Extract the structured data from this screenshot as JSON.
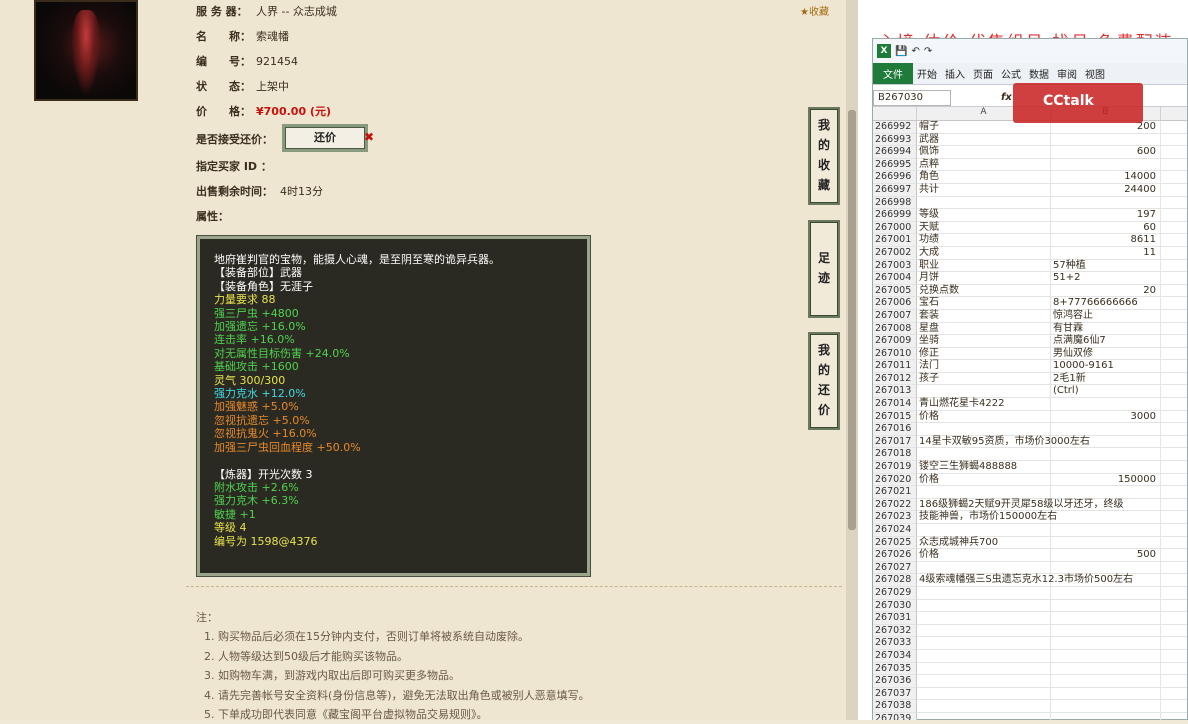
{
  "item": {
    "server_label": "服 务 器：",
    "server": "人界 -- 众志成城",
    "name_label": "名　　称：",
    "name": "索魂幡",
    "id_label": "编　　号：",
    "id": "921454",
    "status_label": "状　　态：",
    "status": "上架中",
    "price_label": "价　　格：",
    "price": "¥700.00 (元)",
    "bargain_label": "是否接受还价：",
    "bargain_button": "还价",
    "buyer_label": "指定买家 ID ：",
    "remaining_label": "出售剩余时间：",
    "remaining": "4时13分",
    "attr_label": "属性：",
    "favorite": "收藏"
  },
  "attributes": [
    {
      "text": "地府崔判官的宝物，能摄人心魂，是至阴至寒的诡异兵器。",
      "color": "white"
    },
    {
      "text": "【装备部位】武器",
      "color": "white"
    },
    {
      "text": "【装备角色】无涯子",
      "color": "white"
    },
    {
      "text": "力量要求 88",
      "color": "yellow"
    },
    {
      "text": "强三尸虫 +4800",
      "color": "green"
    },
    {
      "text": "加强遗忘 +16.0%",
      "color": "green"
    },
    {
      "text": "连击率 +16.0%",
      "color": "green"
    },
    {
      "text": "对无属性目标伤害 +24.0%",
      "color": "green"
    },
    {
      "text": "基础攻击 +1600",
      "color": "green"
    },
    {
      "text": "灵气 300/300",
      "color": "yellow"
    },
    {
      "text": "强力克水 +12.0%",
      "color": "cyan"
    },
    {
      "text": "加强魅惑 +5.0%",
      "color": "orange"
    },
    {
      "text": "忽视抗遗忘 +5.0%",
      "color": "orange"
    },
    {
      "text": "忽视抗鬼火 +16.0%",
      "color": "orange"
    },
    {
      "text": "加强三尸虫回血程度 +50.0%",
      "color": "orange"
    },
    {
      "text": "",
      "color": "white"
    },
    {
      "text": "【炼器】开光次数 3",
      "color": "white"
    },
    {
      "text": "附水攻击 +2.6%",
      "color": "green"
    },
    {
      "text": "强力克木 +6.3%",
      "color": "green"
    },
    {
      "text": "敏捷 +1",
      "color": "green"
    },
    {
      "text": "等级 4",
      "color": "yellow"
    },
    {
      "text": "编号为 1598@4376",
      "color": "yellow"
    }
  ],
  "notes": {
    "title": "注：",
    "items": [
      "1. 购买物品后必须在15分钟内支付，否则订单将被系统自动废除。",
      "2. 人物等级达到50级后才能购买该物品。",
      "3. 如购物车满，到游戏内取出后即可购买更多物品。",
      "4. 请先完善帐号安全资料(身份信息等)，避免无法取出角色或被别人恶意填写。",
      "5. 下单成功即代表同意《藏宝阁平台虚拟物品交易规则》。"
    ]
  },
  "side_tabs": {
    "favorites": [
      "我",
      "的",
      "收",
      "藏"
    ],
    "footprint": [
      "足",
      "迹"
    ],
    "bargain": [
      "我",
      "的",
      "还",
      "价"
    ]
  },
  "excel": {
    "bg_banner": "心境 估价 代售组号 找号 免费配装",
    "ribbon_file": "文件",
    "ribbon_tabs": [
      "开始",
      "插入",
      "页面",
      "公式",
      "数据",
      "审阅",
      "视图"
    ],
    "name_box": "B267030",
    "col_a": "A",
    "col_b": "B",
    "watermark": "CCtalk",
    "rows": [
      {
        "n": "266992",
        "a": "帽子",
        "b": "200"
      },
      {
        "n": "266993",
        "a": "武器",
        "b": ""
      },
      {
        "n": "266994",
        "a": "佩饰",
        "b": "600"
      },
      {
        "n": "266995",
        "a": "点粹",
        "b": ""
      },
      {
        "n": "266996",
        "a": "角色",
        "b": "14000"
      },
      {
        "n": "266997",
        "a": "共计",
        "b": "24400"
      },
      {
        "n": "266998",
        "a": "",
        "b": ""
      },
      {
        "n": "266999",
        "a": "等级",
        "b": "197"
      },
      {
        "n": "267000",
        "a": "天赋",
        "b": "60"
      },
      {
        "n": "267001",
        "a": "功绩",
        "b": "8611"
      },
      {
        "n": "267002",
        "a": "大成",
        "b": "11"
      },
      {
        "n": "267003",
        "a": "职业",
        "b": "57种植",
        "bl": true
      },
      {
        "n": "267004",
        "a": "月饼",
        "b": "51+2",
        "bl": true
      },
      {
        "n": "267005",
        "a": "兑换点数",
        "b": "20"
      },
      {
        "n": "267006",
        "a": "宝石",
        "b": "8+77766666666",
        "bl": true
      },
      {
        "n": "267007",
        "a": "套装",
        "b": "惊鸿容止",
        "bl": true
      },
      {
        "n": "267008",
        "a": "星盘",
        "b": "有甘霖",
        "bl": true
      },
      {
        "n": "267009",
        "a": "坐骑",
        "b": "点满魔6仙7",
        "bl": true
      },
      {
        "n": "267010",
        "a": "修正",
        "b": "男仙双修",
        "bl": true
      },
      {
        "n": "267011",
        "a": "法门",
        "b": "10000-9161",
        "bl": true
      },
      {
        "n": "267012",
        "a": "孩子",
        "b": "2毛1新",
        "bl": true
      },
      {
        "n": "267013",
        "a": "",
        "b": "(Ctrl)",
        "bl": true
      },
      {
        "n": "267014",
        "a": "青山燃花星卡4222",
        "b": ""
      },
      {
        "n": "267015",
        "a": "价格",
        "b": "3000"
      },
      {
        "n": "267016",
        "a": "",
        "b": ""
      },
      {
        "n": "267017",
        "a": "14星卡双敏95资质，市场价3000左右",
        "b": ""
      },
      {
        "n": "267018",
        "a": "",
        "b": ""
      },
      {
        "n": "267019",
        "a": "镂空三生狮蝎488888",
        "b": ""
      },
      {
        "n": "267020",
        "a": "价格",
        "b": "150000"
      },
      {
        "n": "267021",
        "a": "",
        "b": ""
      },
      {
        "n": "267022",
        "a": "186级狮蝎2天赋9开灵犀58级以牙还牙，终级",
        "b": ""
      },
      {
        "n": "267023",
        "a": "技能神兽，市场价150000左右",
        "b": ""
      },
      {
        "n": "267024",
        "a": "",
        "b": ""
      },
      {
        "n": "267025",
        "a": "众志成城神兵700",
        "b": ""
      },
      {
        "n": "267026",
        "a": "价格",
        "b": "500"
      },
      {
        "n": "267027",
        "a": "",
        "b": ""
      },
      {
        "n": "267028",
        "a": "4级索魂幡强三S虫遗忘克水12.3市场价500左右",
        "b": ""
      },
      {
        "n": "267029",
        "a": "",
        "b": ""
      },
      {
        "n": "267030",
        "a": "",
        "b": ""
      },
      {
        "n": "267031",
        "a": "",
        "b": ""
      },
      {
        "n": "267032",
        "a": "",
        "b": ""
      },
      {
        "n": "267033",
        "a": "",
        "b": ""
      },
      {
        "n": "267034",
        "a": "",
        "b": ""
      },
      {
        "n": "267035",
        "a": "",
        "b": ""
      },
      {
        "n": "267036",
        "a": "",
        "b": ""
      },
      {
        "n": "267037",
        "a": "",
        "b": ""
      },
      {
        "n": "267038",
        "a": "",
        "b": ""
      },
      {
        "n": "267039",
        "a": "",
        "b": ""
      }
    ]
  }
}
